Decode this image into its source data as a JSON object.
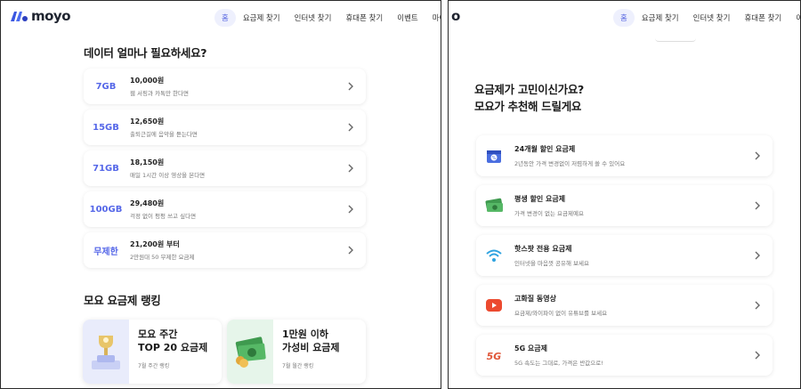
{
  "brand": {
    "name": "moyo",
    "cropped_name": "o"
  },
  "nav": {
    "items_left": [
      "홈",
      "요금제 찾기",
      "인터넷 찾기",
      "휴대폰 찾기",
      "이벤트",
      "마이페이지"
    ],
    "items_right": [
      "홈",
      "요금제 찾기",
      "인터넷 찾기",
      "휴대폰 찾기",
      "이벤트"
    ]
  },
  "data_section": {
    "title": "데이터 얼마나 필요하세요?",
    "options": [
      {
        "amount": "7GB",
        "price": "10,000원",
        "desc": "웹 서핑과 카톡만 한다면"
      },
      {
        "amount": "15GB",
        "price": "12,650원",
        "desc": "출퇴근길에 음악을 듣는다면"
      },
      {
        "amount": "71GB",
        "price": "18,150원",
        "desc": "매일 1시간 이상 영상을 본다면"
      },
      {
        "amount": "100GB",
        "price": "29,480원",
        "desc": "걱정 없이 펑펑 쓰고 싶다면"
      },
      {
        "amount": "무제한",
        "price": "21,200원 부터",
        "desc": "2만원대 50 무제한 요금제"
      }
    ]
  },
  "ranking": {
    "title": "모요 요금제 랭킹",
    "cards": [
      {
        "line1": "모요 주간",
        "line2": "TOP 20 요금제",
        "sub": "7월 주간 랭킹"
      },
      {
        "line1": "1만원 이하",
        "line2": "가성비 요금제",
        "sub": "7월 월간 랭킹"
      }
    ]
  },
  "recommend": {
    "title_line1": "요금제가 고민이신가요?",
    "title_line2": "모요가 추천해 드릴게요",
    "items": [
      {
        "icon": "calendar-discount-icon",
        "title": "24개월 할인 요금제",
        "desc": "2년동안 가격 변경없이 저렴하게 쓸 수 있어요"
      },
      {
        "icon": "money-bills-icon",
        "title": "평생 할인 요금제",
        "desc": "가격 변경이 없는 요금제예요"
      },
      {
        "icon": "wifi-icon",
        "title": "핫스팟 전용 요금제",
        "desc": "인터넷을 마음껏 공유해 보세요"
      },
      {
        "icon": "video-play-icon",
        "title": "고화질 동영상",
        "desc": "요금제/와이파이 없이 유튜브를 보세요"
      },
      {
        "icon": "5g-icon",
        "title": "5G 요금제",
        "desc": "5G 속도는 그대로, 가격은 반값으로!"
      }
    ]
  },
  "colors": {
    "accent": "#5567e8",
    "nav_active_bg": "#eef0fd",
    "text": "#222222"
  }
}
